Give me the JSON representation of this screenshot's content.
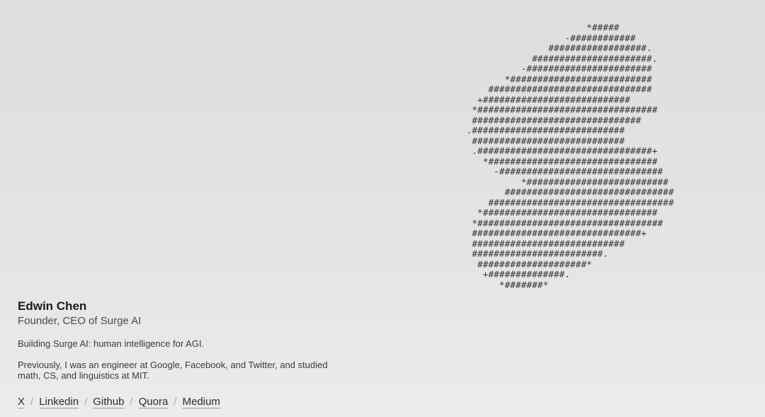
{
  "ascii_art": [
    "                           *#####",
    "                       -############",
    "                    ##################.",
    "                 ######################.",
    "               -#######################",
    "            *##########################",
    "         ##############################",
    "       +###########################",
    "      *#################################",
    "      ###############################",
    "     .############################",
    "      ############################",
    "      .################################+",
    "        *###############################",
    "          -##############################",
    "               *##########################",
    "            ###############################",
    "         ##################################",
    "       *################################",
    "      *##################################",
    "      ###############################+",
    "      ############################",
    "      ########################.",
    "       ####################*",
    "        +##############.",
    "           *#######*"
  ],
  "profile": {
    "name": "Edwin Chen",
    "title": "Founder, CEO of Surge AI",
    "tagline": "Building Surge AI: human intelligence for AGI.",
    "history": "Previously, I was an engineer at Google, Facebook, and Twitter, and studied math, CS, and linguistics at MIT."
  },
  "links": [
    {
      "label": "X"
    },
    {
      "label": "Linkedin"
    },
    {
      "label": "Github"
    },
    {
      "label": "Quora"
    },
    {
      "label": "Medium"
    }
  ],
  "link_separator": "/"
}
